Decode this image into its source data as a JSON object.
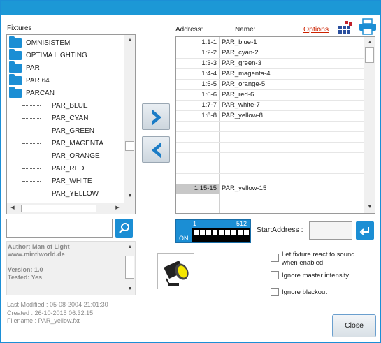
{
  "headers": {
    "fixtures": "Fixtures",
    "address": "Address:",
    "name": "Name:",
    "options": "Options"
  },
  "tree": {
    "folders": [
      "OMNISISTEM",
      "OPTIMA LIGHTING",
      "PAR",
      "PAR 64",
      "PARCAN"
    ],
    "children": [
      "PAR_BLUE",
      "PAR_CYAN",
      "PAR_GREEN",
      "PAR_MAGENTA",
      "PAR_ORANGE",
      "PAR_RED",
      "PAR_WHITE",
      "PAR_YELLOW"
    ]
  },
  "patch_list": [
    {
      "address": "1:1-1",
      "name": "PAR_blue-1"
    },
    {
      "address": "1:2-2",
      "name": "PAR_cyan-2"
    },
    {
      "address": "1:3-3",
      "name": "PAR_green-3"
    },
    {
      "address": "1:4-4",
      "name": "PAR_magenta-4"
    },
    {
      "address": "1:5-5",
      "name": "PAR_orange-5"
    },
    {
      "address": "1:6-6",
      "name": "PAR_red-6"
    },
    {
      "address": "1:7-7",
      "name": "PAR_white-7"
    },
    {
      "address": "1:8-8",
      "name": "PAR_yellow-8"
    }
  ],
  "preview_row": {
    "address": "1:15-15",
    "name": "PAR_yellow-15"
  },
  "dip": {
    "low": "1",
    "high": "512",
    "on": "ON"
  },
  "start_address": {
    "label": "StartAddress :",
    "value": ""
  },
  "search": {
    "value": ""
  },
  "info": {
    "author": "Author: Man of Light",
    "website": "www.mintiworld.de",
    "version": "Version: 1.0",
    "tested": "Tested: Yes"
  },
  "meta": {
    "last_modified": "Last Modified : 05-08-2004 21:01:30",
    "created": "Created : 26-10-2015 06:32:15",
    "filename": "Filename : PAR_yellow.fxt"
  },
  "options": {
    "react_sound": "Let fixture react to sound when enabled",
    "ignore_master": "Ignore master intensity",
    "ignore_blackout": "Ignore blackout"
  },
  "close_label": "Close",
  "colors": {
    "accent": "#1c98d6",
    "link": "#cc2200",
    "bulb": "#f5e600"
  }
}
